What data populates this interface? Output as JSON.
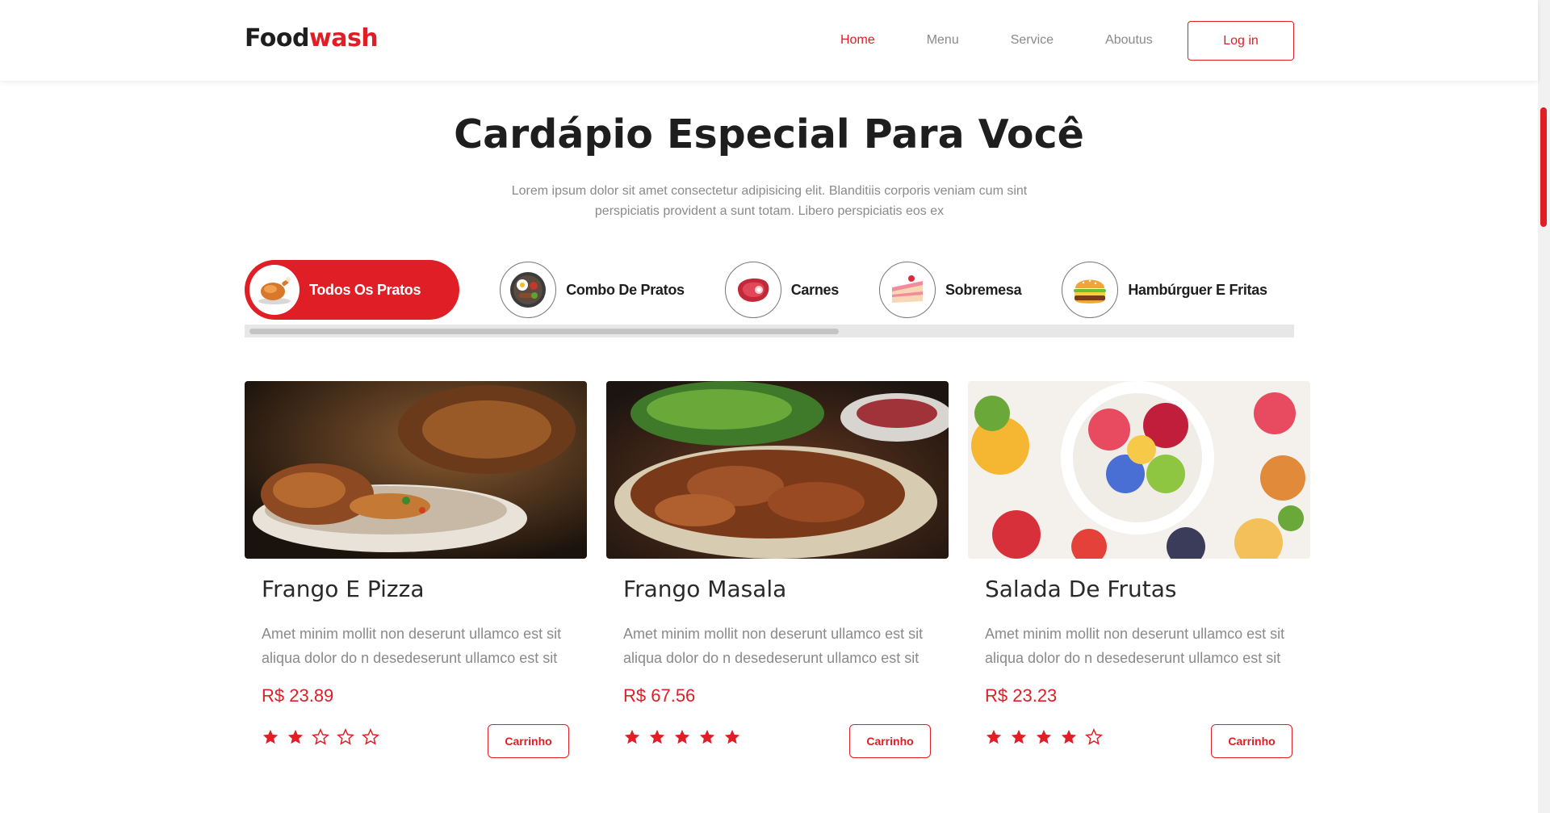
{
  "brand": {
    "part1": "Food",
    "part2": "wash",
    "accent": "#e01e25"
  },
  "nav": {
    "items": [
      {
        "label": "Home",
        "active": true
      },
      {
        "label": "Menu",
        "active": false
      },
      {
        "label": "Service",
        "active": false
      },
      {
        "label": "Aboutus",
        "active": false
      }
    ],
    "login_label": "Log in"
  },
  "hero": {
    "title": "Cardápio Especial Para Você",
    "subtitle": "Lorem ipsum dolor sit amet consectetur adipisicing elit. Blanditiis corporis veniam cum sint perspiciatis provident a sunt totam. Libero perspiciatis eos ex"
  },
  "categories": [
    {
      "label": "Todos Os Pratos",
      "icon": "roast-chicken-icon",
      "active": true
    },
    {
      "label": "Combo De Pratos",
      "icon": "meal-platter-icon",
      "active": false
    },
    {
      "label": "Carnes",
      "icon": "steak-icon",
      "active": false
    },
    {
      "label": "Sobremesa",
      "icon": "cake-slice-icon",
      "active": false
    },
    {
      "label": "Hambúrguer E Fritas",
      "icon": "burger-icon",
      "active": false
    },
    {
      "label": "",
      "icon": "drink-icon",
      "active": false
    }
  ],
  "cards": [
    {
      "name": "Frango E Pizza",
      "desc": "Amet minim mollit non deserunt ullamco est sit aliqua dolor do n desedeserunt ullamco est sit",
      "price": "R$ 23.89",
      "rating": 2,
      "cart_label": "Carrinho",
      "image": "roast-chicken-plate-photo"
    },
    {
      "name": "Frango Masala",
      "desc": "Amet minim mollit non deserunt ullamco est sit aliqua dolor do n desedeserunt ullamco est sit",
      "price": "R$ 67.56",
      "rating": 5,
      "cart_label": "Carrinho",
      "image": "grilled-chicken-skewers-photo"
    },
    {
      "name": "Salada De Frutas",
      "desc": "Amet minim mollit non deserunt ullamco est sit aliqua dolor do n desedeserunt ullamco est sit",
      "price": "R$ 23.23",
      "rating": 4,
      "cart_label": "Carrinho",
      "image": "fruit-salad-bowl-photo"
    }
  ]
}
